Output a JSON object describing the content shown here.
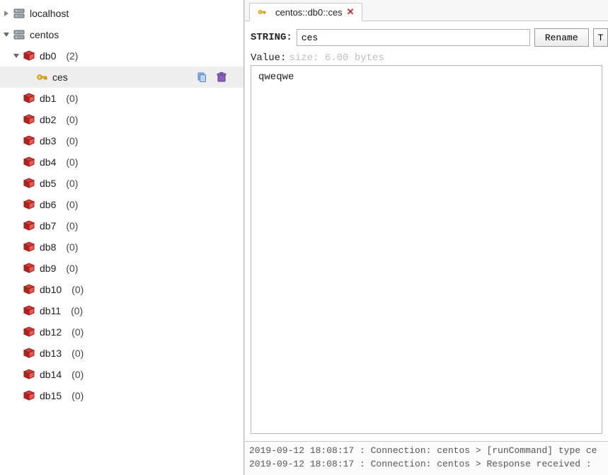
{
  "sidebar": {
    "roots": [
      {
        "name": "localhost",
        "expanded": false
      },
      {
        "name": "centos",
        "expanded": true
      }
    ],
    "databases": [
      {
        "name": "db0",
        "count": "(2)",
        "expanded": true,
        "keys": [
          {
            "name": "ces",
            "selected": true
          }
        ]
      },
      {
        "name": "db1",
        "count": "(0)"
      },
      {
        "name": "db2",
        "count": "(0)"
      },
      {
        "name": "db3",
        "count": "(0)"
      },
      {
        "name": "db4",
        "count": "(0)"
      },
      {
        "name": "db5",
        "count": "(0)"
      },
      {
        "name": "db6",
        "count": "(0)"
      },
      {
        "name": "db7",
        "count": "(0)"
      },
      {
        "name": "db8",
        "count": "(0)"
      },
      {
        "name": "db9",
        "count": "(0)"
      },
      {
        "name": "db10",
        "count": "(0)"
      },
      {
        "name": "db11",
        "count": "(0)"
      },
      {
        "name": "db12",
        "count": "(0)"
      },
      {
        "name": "db13",
        "count": "(0)"
      },
      {
        "name": "db14",
        "count": "(0)"
      },
      {
        "name": "db15",
        "count": "(0)"
      }
    ]
  },
  "tab": {
    "title": "centos::db0::ces"
  },
  "detail": {
    "type_label": "STRING:",
    "key_name": "ces",
    "rename_label": "Rename",
    "ttl_label": "T",
    "value_label": "Value:",
    "size_hint": "size: 6.00 bytes",
    "value": "qweqwe"
  },
  "log": {
    "line1": "2019-09-12 18:08:17 : Connection: centos > [runCommand] type ce",
    "line2": "2019-09-12 18:08:17 : Connection: centos > Response received :"
  }
}
